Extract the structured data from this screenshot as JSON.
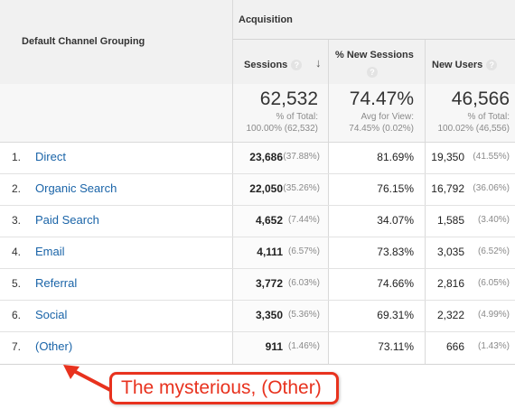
{
  "header": {
    "group_label": "Acquisition",
    "dimension_label": "Default Channel Grouping",
    "col_sessions": "Sessions",
    "col_new_sessions": "% New Sessions",
    "col_new_users": "New Users",
    "help_glyph": "?",
    "sort_glyph": "↓"
  },
  "totals": {
    "sessions": "62,532",
    "sessions_sub1": "% of Total:",
    "sessions_sub2": "100.00% (62,532)",
    "new_sessions": "74.47%",
    "new_sessions_sub1": "Avg for View:",
    "new_sessions_sub2": "74.45% (0.02%)",
    "new_users": "46,566",
    "new_users_sub1": "% of Total:",
    "new_users_sub2": "100.02% (46,556)"
  },
  "rows": [
    {
      "idx": "1.",
      "name": "Direct",
      "sessions": "23,686",
      "sessions_pct": "(37.88%)",
      "new_sessions": "81.69%",
      "new_users": "19,350",
      "new_users_pct": "(41.55%)"
    },
    {
      "idx": "2.",
      "name": "Organic Search",
      "sessions": "22,050",
      "sessions_pct": "(35.26%)",
      "new_sessions": "76.15%",
      "new_users": "16,792",
      "new_users_pct": "(36.06%)"
    },
    {
      "idx": "3.",
      "name": "Paid Search",
      "sessions": "4,652",
      "sessions_pct": "(7.44%)",
      "new_sessions": "34.07%",
      "new_users": "1,585",
      "new_users_pct": "(3.40%)"
    },
    {
      "idx": "4.",
      "name": "Email",
      "sessions": "4,111",
      "sessions_pct": "(6.57%)",
      "new_sessions": "73.83%",
      "new_users": "3,035",
      "new_users_pct": "(6.52%)"
    },
    {
      "idx": "5.",
      "name": "Referral",
      "sessions": "3,772",
      "sessions_pct": "(6.03%)",
      "new_sessions": "74.66%",
      "new_users": "2,816",
      "new_users_pct": "(6.05%)"
    },
    {
      "idx": "6.",
      "name": "Social",
      "sessions": "3,350",
      "sessions_pct": "(5.36%)",
      "new_sessions": "69.31%",
      "new_users": "2,322",
      "new_users_pct": "(4.99%)"
    },
    {
      "idx": "7.",
      "name": "(Other)",
      "sessions": "911",
      "sessions_pct": "(1.46%)",
      "new_sessions": "73.11%",
      "new_users": "666",
      "new_users_pct": "(1.43%)"
    }
  ],
  "annotation": {
    "text": "The mysterious, (Other)",
    "color": "#e8321e"
  },
  "colors": {
    "link": "#1a64a8",
    "header_bg": "#f1f1f1"
  }
}
